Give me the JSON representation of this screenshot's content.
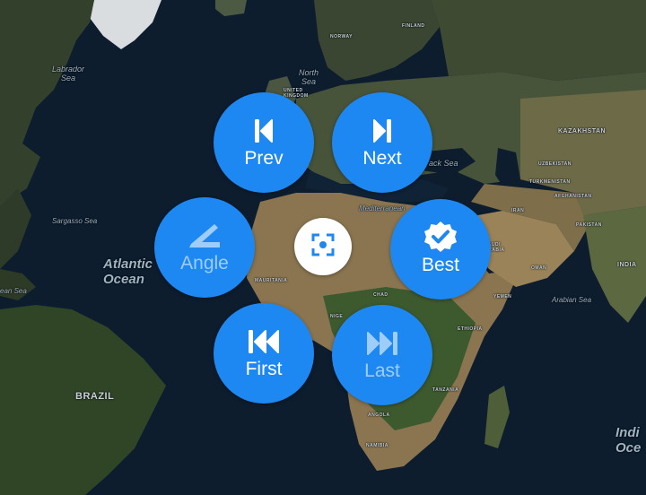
{
  "map": {
    "labels": {
      "labrador_sea": "Labrador\nSea",
      "north_sea": "North\nSea",
      "sargasso_sea": "Sargasso Sea",
      "atlantic_ocean": "Atlantic\nOcean",
      "ocean_left": "ean Sea",
      "mediterranean": "Mediterranean",
      "black_sea": "ack Sea",
      "arabian_sea": "Arabian Sea",
      "indian_ocean": "Indi\nOce",
      "kazakhstan": "KAZAKHSTAN",
      "india": "INDIA",
      "brazil": "BRAZIL",
      "finland": "FINLAND",
      "norway": "NORWAY",
      "united_kingdom": "UNITED\nKINGDOM",
      "mauritania": "MAURITANIA",
      "chad": "CHAD",
      "ethiopia": "ETHIOPIA",
      "tanzania": "TANZANIA",
      "angola": "ANGOLA",
      "namibia": "NAMIBIA",
      "nigeria": "NIGE",
      "yemen": "YEMEN",
      "oman": "OMAN",
      "pakistan": "PAKISTAN",
      "afghanistan": "AFGHANISTAN",
      "turkmenistan": "TURKMENISTAN",
      "uzbekistan": "UZBEKISTAN",
      "iran": "IRAN",
      "saudi": "SAUDI\nARABIA"
    }
  },
  "controls": {
    "prev": {
      "label": "Prev",
      "icon": "skip-previous-icon",
      "enabled": true
    },
    "next": {
      "label": "Next",
      "icon": "skip-next-icon",
      "enabled": true
    },
    "angle": {
      "label": "Angle",
      "icon": "angle-icon",
      "enabled": false
    },
    "best": {
      "label": "Best",
      "icon": "verified-badge-icon",
      "enabled": true
    },
    "first": {
      "label": "First",
      "icon": "skip-to-first-icon",
      "enabled": true
    },
    "last": {
      "label": "Last",
      "icon": "skip-to-last-icon",
      "enabled": false
    },
    "center": {
      "icon": "focus-center-icon"
    }
  },
  "colors": {
    "accent": "#1e88f2",
    "disabled_text": "#9fcdfa",
    "ocean": "#0d1d2e"
  }
}
